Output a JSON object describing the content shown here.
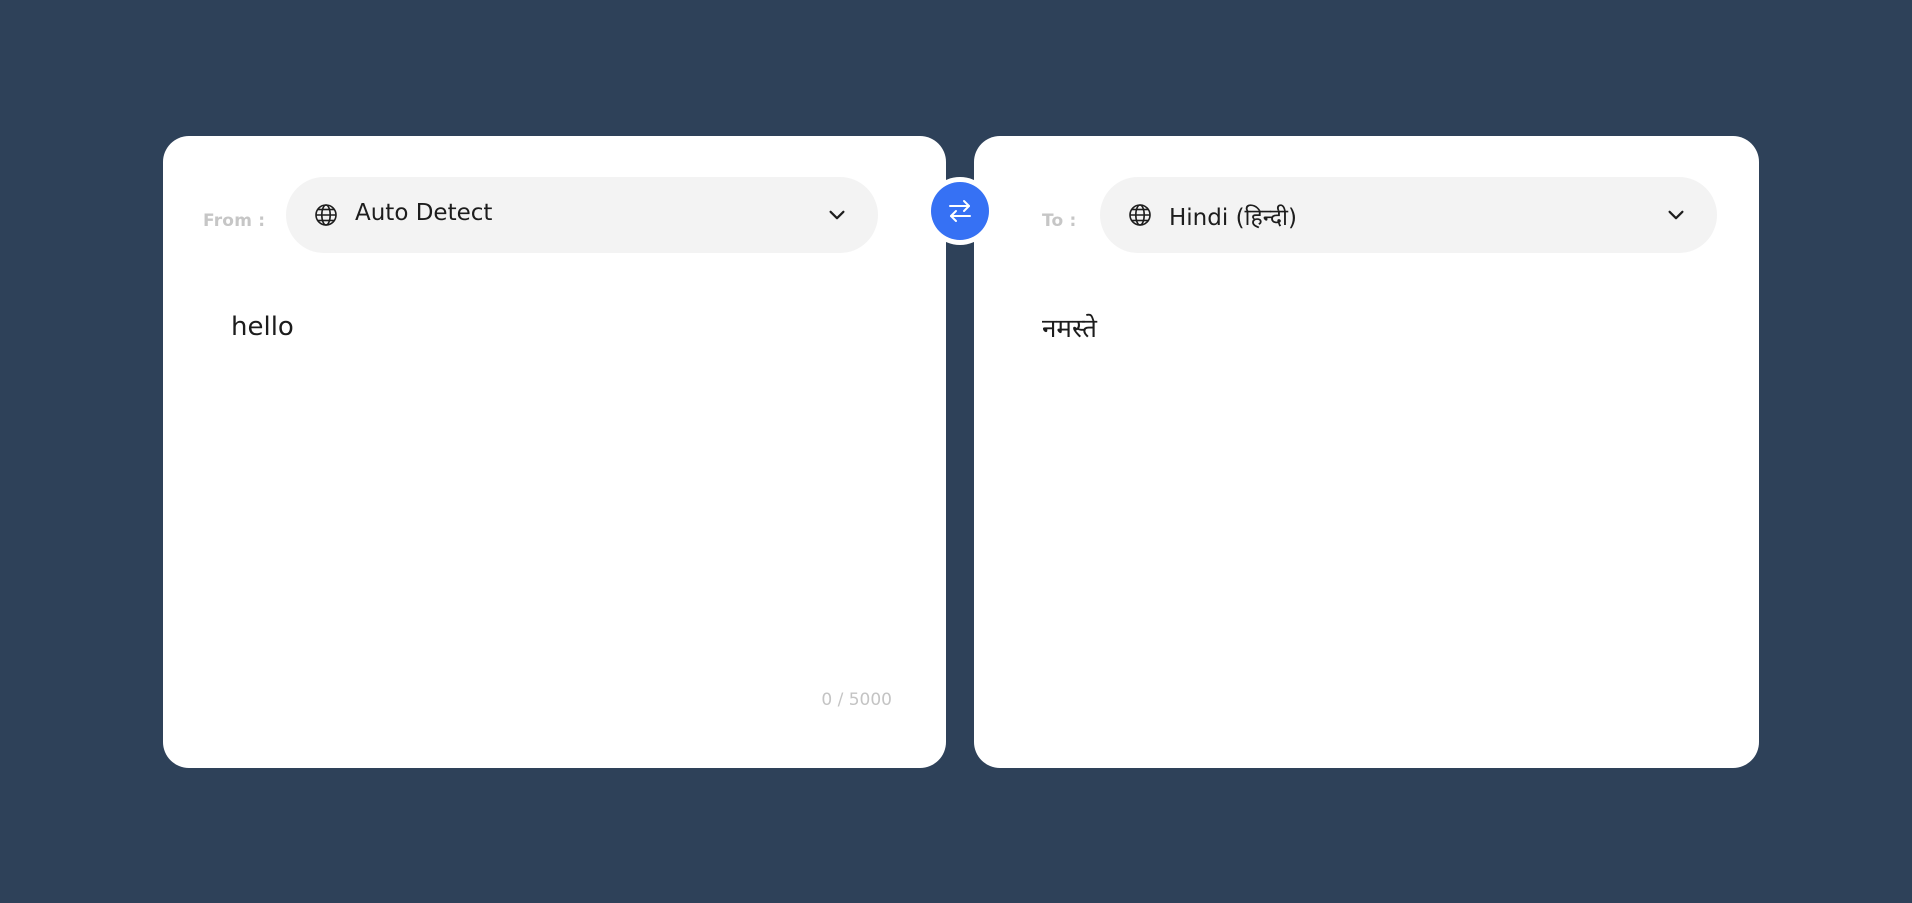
{
  "source": {
    "label": "From :",
    "language": "Auto Detect",
    "icon": "globe-icon",
    "text": "hello",
    "char_count": "0 / 5000"
  },
  "target": {
    "label": "To :",
    "language": "Hindi (हिन्दी)",
    "icon": "globe-icon",
    "text": "नमस्ते"
  },
  "swap": {
    "icon": "swap-arrows-icon"
  },
  "colors": {
    "background": "#2e4159",
    "accent": "#3671f4",
    "panel": "#ffffff",
    "select_bg": "#f3f3f3"
  }
}
